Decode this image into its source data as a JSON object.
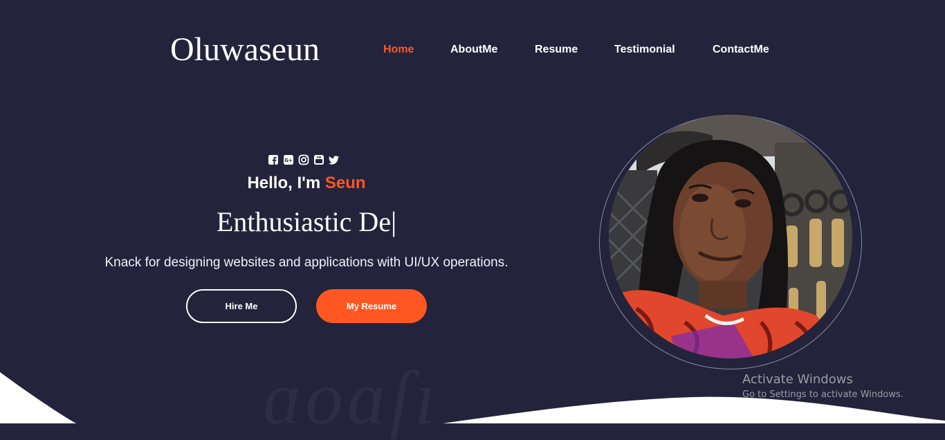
{
  "brand": {
    "name": "Oluwaseun"
  },
  "nav": {
    "items": [
      {
        "label": "Home",
        "active": true
      },
      {
        "label": "AboutMe",
        "active": false
      },
      {
        "label": "Resume",
        "active": false
      },
      {
        "label": "Testimonial",
        "active": false
      },
      {
        "label": "ContactMe",
        "active": false
      }
    ]
  },
  "social": [
    "facebook-icon",
    "google-plus-icon",
    "instagram-icon",
    "youtube-icon",
    "twitter-icon"
  ],
  "hero": {
    "greeting": "Hello, I'm",
    "name": "Seun",
    "typed_text": "Enthusiastic De",
    "cursor": "|",
    "description": "Knack for designing websites and applications with UI/UX operations.",
    "hire_label": "Hire Me",
    "resume_label": "My Resume"
  },
  "watermark": {
    "title": "Activate Windows",
    "subtitle": "Go to Settings to activate Windows."
  },
  "colors": {
    "background": "#23243b",
    "accent": "#ff5722",
    "text": "#ffffff"
  }
}
